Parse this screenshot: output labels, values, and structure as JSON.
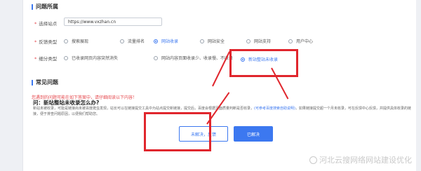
{
  "issue_section": {
    "title": "问题所属"
  },
  "site": {
    "label": "选择站点",
    "value": "https://www.vxzhan.cn"
  },
  "feedback_type": {
    "label": "反馈类型",
    "options": [
      "搜索展现",
      "流量排名",
      "网站收录",
      "网站安全",
      "网站支持",
      "用户中心"
    ],
    "selected": "网站收录"
  },
  "subtype": {
    "label": "细分类型",
    "options": [
      "已收录网页内容突然消失",
      "网站内容页面收录少、收录慢、不收录",
      "新站整站未收录"
    ],
    "selected": "新站整站未收录"
  },
  "faq": {
    "title": "常见问题",
    "warning": "您遇到的问题可能在如下答案中，请仔细阅读以下内容！",
    "question": "问：新站整站未收录怎么办?",
    "answer": "新站未被收录，可能是链接尚未被百度爬虫发现，站长可以在链接提交工具中为站点提交新链接，提交后，百度会根据页面质量判断是否收录，",
    "answer_link": "(可参考百度搜索自助说明)",
    "answer_tail": "，如果链接提交超一个月未收录，可在反馈中心反馈，并提供具体收录的链接，便于排查问题原因，以便我们帮助您。"
  },
  "buttons": {
    "unsolved": "未解决，反馈",
    "solved": "已解决"
  },
  "watermark": "河北云搜网络网站建设优化",
  "colors": {
    "accent": "#3c78f0",
    "annotation": "#e0262d",
    "warning": "#e5484d"
  }
}
